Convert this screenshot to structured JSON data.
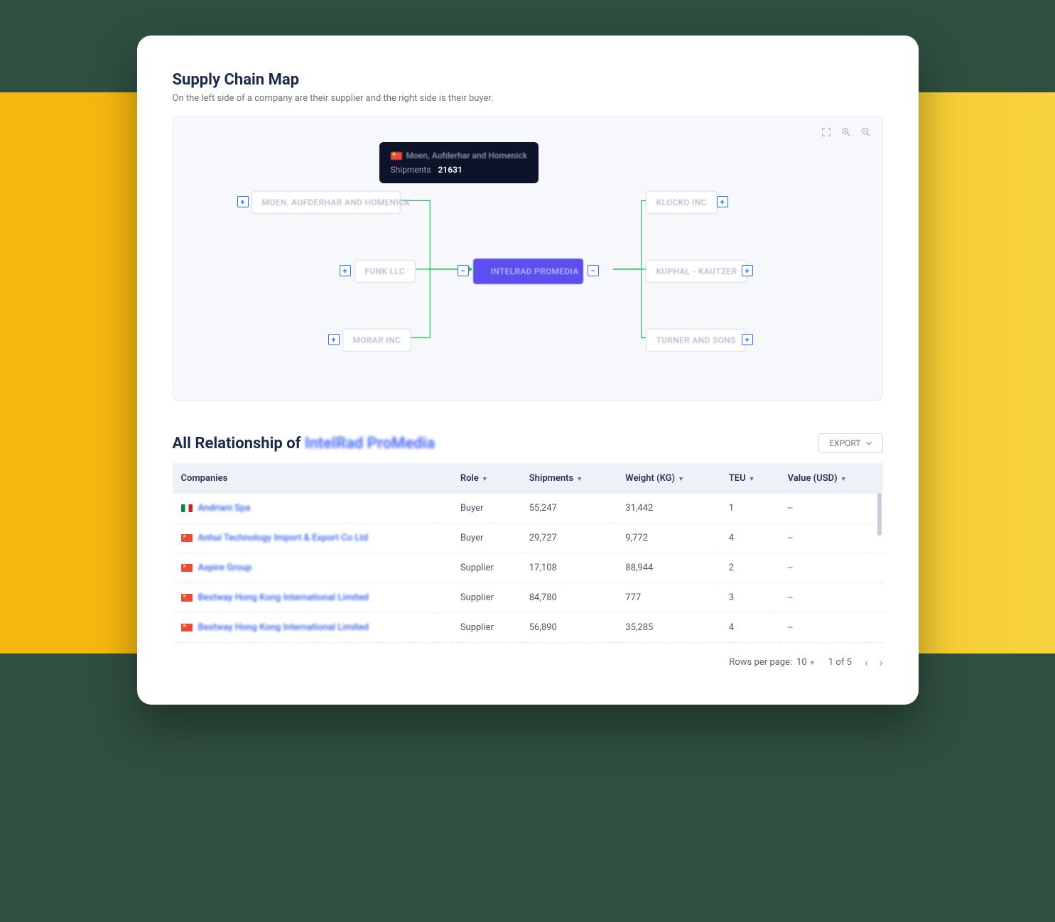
{
  "header": {
    "title": "Supply Chain Map",
    "subtitle": "On the left side of a company are their supplier and the right side is their buyer."
  },
  "tooltip": {
    "company": "Moen, Aufderhar and Homenick",
    "shipments_label": "Shipments",
    "shipments_value": "21631"
  },
  "map": {
    "suppliers": [
      "MOEN, AUFDERHAR AND HOMENICK",
      "FUNK LLC",
      "MORAR INC"
    ],
    "center": "INTELRAD PROMEDIA",
    "buyers": [
      "KLOCKO INC",
      "KUPHAL - KAUTZER",
      "TURNER AND SONS"
    ]
  },
  "relationship": {
    "title_prefix": "All Relationship of ",
    "title_company": "IntelRad ProMedia",
    "export_label": "EXPORT",
    "columns": {
      "company": "Companies",
      "role": "Role",
      "shipments": "Shipments",
      "weight": "Weight (KG)",
      "teu": "TEU",
      "value": "Value (USD)"
    },
    "rows": [
      {
        "flag": "it",
        "company": "Andriani Spa",
        "role": "Buyer",
        "shipments": "55,247",
        "weight": "31,442",
        "teu": "1",
        "value": "--"
      },
      {
        "flag": "cn",
        "company": "Anhui Technology Import & Export Co Ltd",
        "role": "Buyer",
        "shipments": "29,727",
        "weight": "9,772",
        "teu": "4",
        "value": "--"
      },
      {
        "flag": "cn",
        "company": "Aspire Group",
        "role": "Supplier",
        "shipments": "17,108",
        "weight": "88,944",
        "teu": "2",
        "value": "--"
      },
      {
        "flag": "cn",
        "company": "Bestway Hong Kong International Limited",
        "role": "Supplier",
        "shipments": "84,780",
        "weight": "777",
        "teu": "3",
        "value": "--"
      },
      {
        "flag": "cn",
        "company": "Bestway Hong Kong International Limited",
        "role": "Supplier",
        "shipments": "56,890",
        "weight": "35,285",
        "teu": "4",
        "value": "--"
      }
    ]
  },
  "pager": {
    "rows_label": "Rows per page:",
    "rows_value": "10",
    "page_text": "1 of 5"
  }
}
